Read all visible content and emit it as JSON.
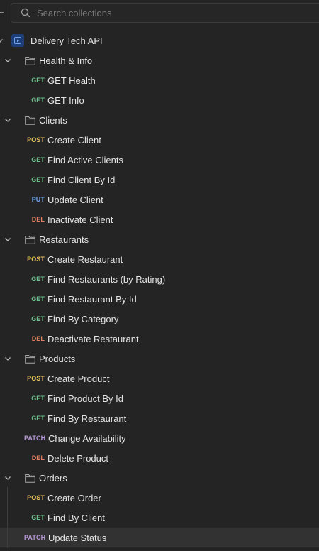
{
  "search": {
    "placeholder": "Search collections"
  },
  "collection": {
    "name": "Delivery Tech API"
  },
  "folders": {
    "health": {
      "name": "Health & Info",
      "requests": [
        {
          "method": "GET",
          "name": "GET Health"
        },
        {
          "method": "GET",
          "name": "GET Info"
        }
      ]
    },
    "clients": {
      "name": "Clients",
      "requests": [
        {
          "method": "POST",
          "name": "Create Client"
        },
        {
          "method": "GET",
          "name": "Find Active Clients"
        },
        {
          "method": "GET",
          "name": "Find Client By Id"
        },
        {
          "method": "PUT",
          "name": "Update Client"
        },
        {
          "method": "DEL",
          "name": "Inactivate Client"
        }
      ]
    },
    "restaurants": {
      "name": "Restaurants",
      "requests": [
        {
          "method": "POST",
          "name": "Create Restaurant"
        },
        {
          "method": "GET",
          "name": "Find Restaurants (by Rating)"
        },
        {
          "method": "GET",
          "name": "Find Restaurant By Id"
        },
        {
          "method": "GET",
          "name": "Find By Category"
        },
        {
          "method": "DEL",
          "name": "Deactivate Restaurant"
        }
      ]
    },
    "products": {
      "name": "Products",
      "requests": [
        {
          "method": "POST",
          "name": "Create Product"
        },
        {
          "method": "GET",
          "name": "Find Product By Id"
        },
        {
          "method": "GET",
          "name": "Find By Restaurant"
        },
        {
          "method": "PATCH",
          "name": "Change Availability"
        },
        {
          "method": "DEL",
          "name": "Delete Product"
        }
      ]
    },
    "orders": {
      "name": "Orders",
      "requests": [
        {
          "method": "POST",
          "name": "Create Order"
        },
        {
          "method": "GET",
          "name": "Find By Client"
        },
        {
          "method": "PATCH",
          "name": "Update Status"
        }
      ]
    }
  }
}
